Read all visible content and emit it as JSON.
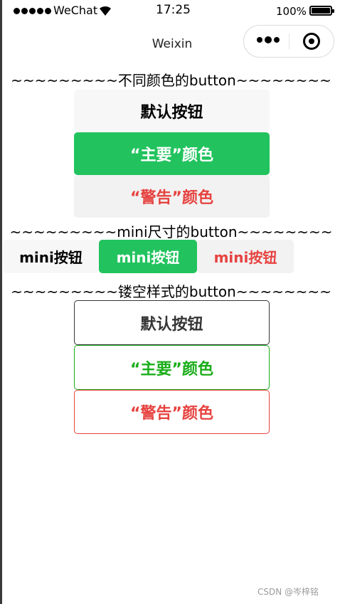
{
  "status_bar": {
    "carrier": "WeChat",
    "time": "17:25",
    "battery_percent": "100%"
  },
  "nav": {
    "title": "Weixin"
  },
  "sections": {
    "colors_title": "~~~~~~~~~不同颜色的button~~~~~~~~",
    "mini_title": "~~~~~~~~~mini尺寸的button~~~~~~~~",
    "plain_title": "~~~~~~~~~镂空样式的button~~~~~~~~"
  },
  "buttons": {
    "default_label": "默认按钮",
    "primary_label": "“主要”颜色",
    "warn_label": "“警告”颜色",
    "mini_label": "mini按钮",
    "plain_default_label": "默认按钮",
    "plain_primary_label": "“主要”颜色",
    "plain_warn_label": "“警告”颜色"
  },
  "watermark": "CSDN @岑梓铭",
  "colors": {
    "primary": "#22c35e",
    "warn": "#e64340",
    "default_bg": "#f7f7f7",
    "plain_primary": "#1aad19"
  }
}
